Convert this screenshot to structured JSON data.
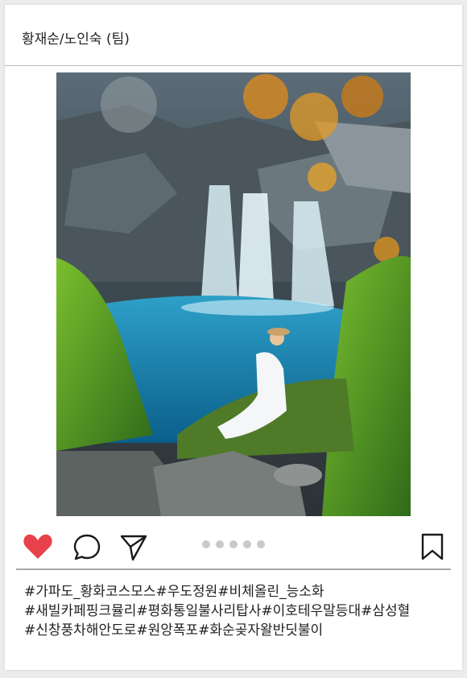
{
  "post": {
    "username": "황재순/노인숙 (팀)",
    "photo_icon": "waterfall-photo",
    "carousel": {
      "count": 5,
      "active_index": 0
    },
    "icons": {
      "like": "heart-icon",
      "comment": "comment-icon",
      "share": "send-icon",
      "save": "bookmark-icon"
    },
    "colors": {
      "like": "#e8414c",
      "icon_stroke": "#1a1a1a"
    },
    "hashtags": [
      "#가파도_황화코스모스#우도정원#비체올린_능소화",
      "#새빌카페핑크뮬리#평화통일불사리탑사#이호테우말등대#삼성혈",
      "#신창풍차해안도로#원앙폭포#화순곶자왈반딧불이"
    ]
  }
}
